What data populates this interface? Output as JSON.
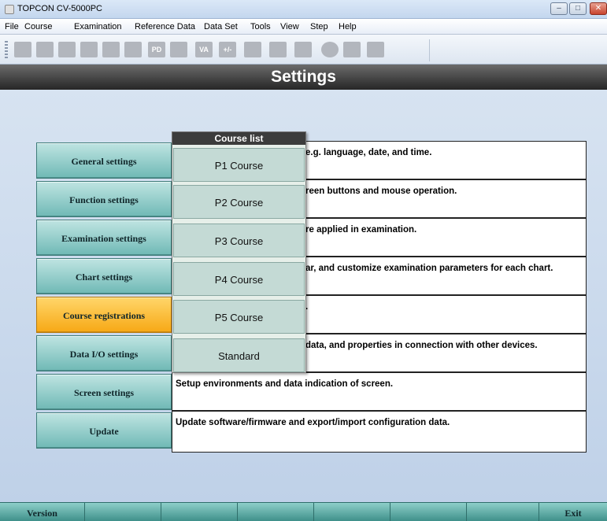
{
  "window": {
    "title": "TOPCON CV-5000PC"
  },
  "menu": [
    "File",
    "Course",
    "Examination",
    "Reference Data",
    "Data Set",
    "Tools",
    "View",
    "Step",
    "Help"
  ],
  "toolbar": {
    "icons": [
      "patient-icon",
      "person-icon",
      "lenses-icon",
      "lenses-icon",
      "chart-icon",
      "folder-icon",
      "pd-icon",
      "monitor-icon",
      "va-icon",
      "plus-minus-icon",
      "display-icon",
      "screen-icon",
      "device-icon",
      "circle-icon",
      "person-icon",
      "wrench-icon"
    ],
    "pd_label": "PD",
    "va_label": "VA",
    "pm_label": "+/-"
  },
  "header": {
    "title": "Settings"
  },
  "settings": [
    {
      "label": "General settings",
      "desc": "e.g. language, date, and time."
    },
    {
      "label": "Function settings",
      "desc": "reen buttons and mouse operation."
    },
    {
      "label": "Examination settings",
      "desc": "re applied in examination."
    },
    {
      "label": "Chart settings",
      "desc": "ar, and customize examination parameters for each chart."
    },
    {
      "label": "Course registrations",
      "desc": "."
    },
    {
      "label": "Data I/O settings",
      "desc": "data, and properties in connection with other devices."
    },
    {
      "label": "Screen settings",
      "desc": "Setup environments and data indication of screen."
    },
    {
      "label": "Update",
      "desc": "Update software/firmware and export/import configuration data."
    }
  ],
  "course_list": {
    "title": "Course list",
    "items": [
      "P1 Course",
      "P2 Course",
      "P3 Course",
      "P4 Course",
      "P5 Course",
      "Standard"
    ]
  },
  "status": {
    "left": "Version",
    "right": "Exit"
  },
  "colors": {
    "header": "#3a3a3a",
    "button": "#7fc0bc",
    "active": "#f7a815"
  }
}
